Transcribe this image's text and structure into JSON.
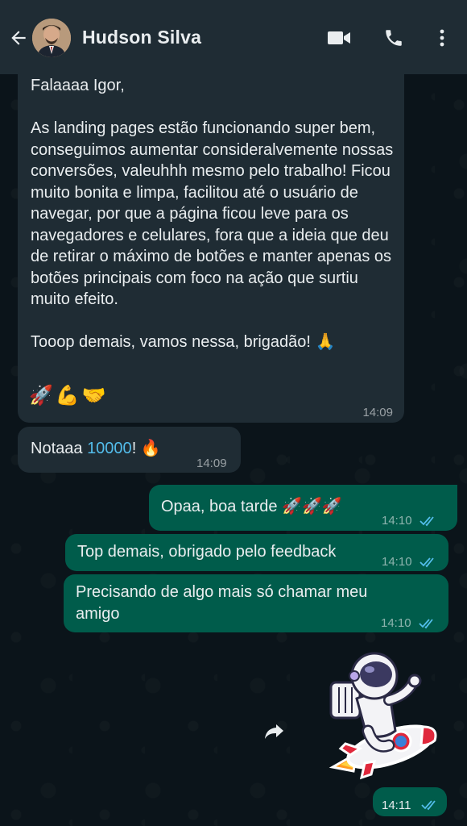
{
  "header": {
    "contact_name": "Hudson Silva"
  },
  "messages": {
    "m1": {
      "text": "Falaaaa Igor,\n\nAs landing pages estão funcionando super bem, conseguimos aumentar consideralvemente nossas conversões, valeuhhh mesmo pelo trabalho! Ficou muito bonita e limpa, facilitou até o usuário de navegar, por que a página ficou leve para os navegadores e celulares, fora que a ideia que deu de retirar o máximo de botões e manter apenas os botões principais com foco na ação que surtiu muito efeito.\n\nTooop demais, vamos nessa, brigadão! 🙏",
      "emojis": "🚀💪🤝",
      "time": "14:09"
    },
    "m2": {
      "text_prefix": "Notaaa ",
      "link": "10000",
      "text_suffix": "! 🔥",
      "time": "14:09"
    },
    "m3": {
      "text": "Opaa, boa tarde 🚀🚀🚀",
      "time": "14:10"
    },
    "m4": {
      "text": "Top demais, obrigado pelo feedback",
      "time": "14:10"
    },
    "m5": {
      "text": "Precisando de algo mais só chamar meu amigo",
      "time": "14:10"
    },
    "m6": {
      "sticker": "astronaut-on-rocket",
      "time": "14:11"
    }
  },
  "colors": {
    "header_bg": "#1f2c34",
    "incoming_bg": "#1f2c34",
    "outgoing_bg": "#005c4b",
    "read_ticks": "#53bdeb",
    "link": "#53bdeb"
  }
}
